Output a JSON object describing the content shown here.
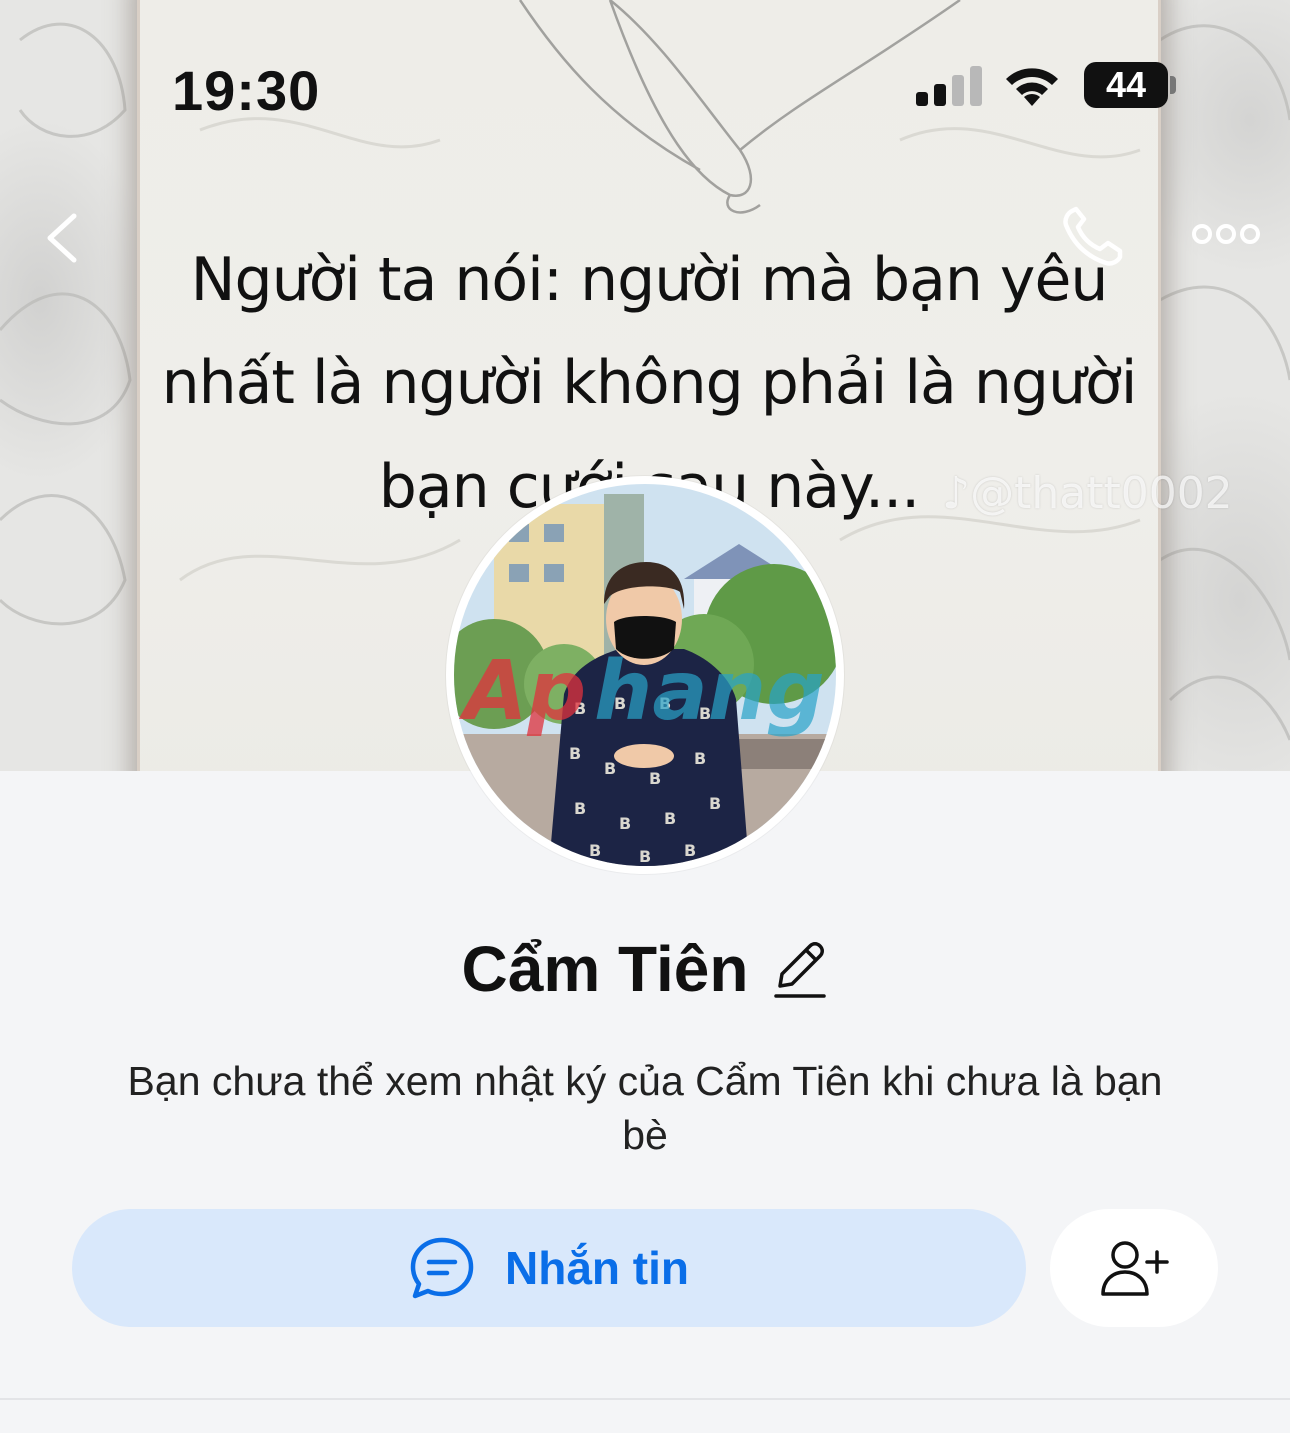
{
  "status_bar": {
    "time": "19:30",
    "battery": "44"
  },
  "cover": {
    "quote_lines": [
      "Người ta nói: người mà bạn yêu",
      "nhất là người không phải là người",
      "bạn cưới sau này..."
    ],
    "watermark": "@thatt0002"
  },
  "profile": {
    "name": "Cẩm Tiên",
    "notice": "Bạn chưa thể xem nhật ký của Cẩm Tiên khi chưa là bạn bè"
  },
  "actions": {
    "message_label": "Nhắn tin"
  },
  "icons": {
    "back": "chevron-left-icon",
    "call": "phone-icon",
    "more": "more-dots-icon",
    "edit": "pencil-icon",
    "message": "chat-bubble-icon",
    "add_friend": "add-friend-icon"
  },
  "colors": {
    "accent": "#0a6ee8",
    "message_button_bg": "#d9e8fb",
    "page_bg": "#f4f5f7"
  }
}
